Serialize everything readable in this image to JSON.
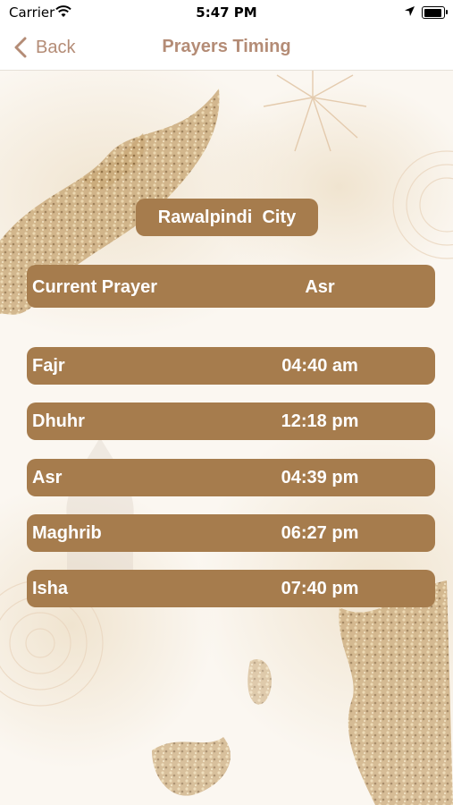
{
  "status_bar": {
    "carrier": "Carrier",
    "time": "5:47 PM"
  },
  "nav": {
    "back_label": "Back",
    "title": "Prayers Timing"
  },
  "city": "Rawalpindi  City",
  "current_prayer": {
    "label": "Current Prayer",
    "value": "Asr"
  },
  "prayers": [
    {
      "name": "Fajr",
      "time": "04:40 am"
    },
    {
      "name": "Dhuhr",
      "time": "12:18 pm"
    },
    {
      "name": "Asr",
      "time": "04:39 pm"
    },
    {
      "name": "Maghrib",
      "time": "06:27 pm"
    },
    {
      "name": "Isha",
      "time": "07:40 pm"
    }
  ],
  "colors": {
    "accent": "#a67c4d",
    "nav_tint": "#b48c76",
    "background": "#fbf7f1"
  }
}
